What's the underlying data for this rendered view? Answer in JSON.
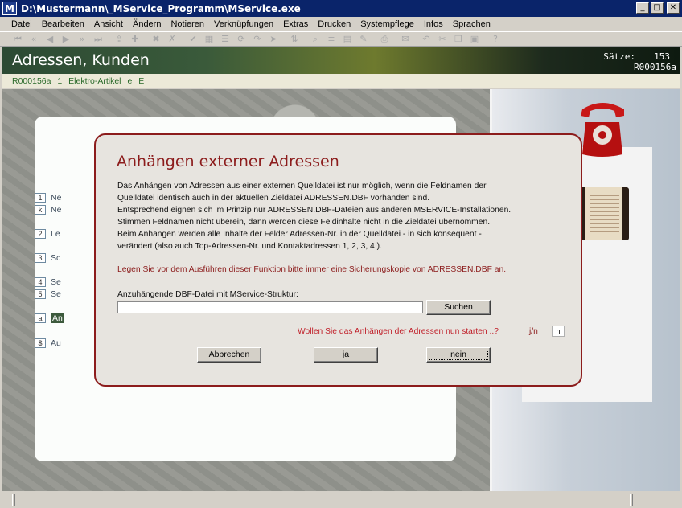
{
  "window": {
    "app_icon": "M",
    "title": "D:\\Mustermann\\_MService_Programm\\MService.exe",
    "minimize": "_",
    "maximize": "□",
    "close": "✕"
  },
  "menu": [
    "Datei",
    "Bearbeiten",
    "Ansicht",
    "Ändern",
    "Notieren",
    "Verknüpfungen",
    "Extras",
    "Drucken",
    "Systempflege",
    "Infos",
    "Sprachen"
  ],
  "toolbar_icons": [
    "first-icon",
    "prev-page-icon",
    "prev-icon",
    "next-icon",
    "next-page-icon",
    "last-icon",
    "sep",
    "import-icon",
    "new-icon",
    "sep",
    "delete-icon",
    "cancel-icon",
    "sep",
    "confirm-icon",
    "record-icon",
    "list-icon",
    "link-icon",
    "link2-icon",
    "link3-icon",
    "sep",
    "sort-icon",
    "sep",
    "search-icon",
    "list2-icon",
    "view-icon",
    "pencil-icon",
    "sep",
    "print-icon",
    "sep",
    "mail-icon",
    "sep",
    "undo-icon",
    "cut-icon",
    "copy-icon",
    "paste-icon",
    "sep",
    "help-icon"
  ],
  "header": {
    "title": "Adressen, Kunden",
    "count_label": "Sätze:",
    "count_value": "153",
    "record_id": "R000156a"
  },
  "info_row": [
    "R000156a",
    "1",
    "Elektro-Artikel",
    "e",
    "E"
  ],
  "side_menu": [
    {
      "key": "1",
      "text": "Ne"
    },
    {
      "key": "k",
      "text": "Ne"
    },
    {
      "key": "2",
      "text": "Le"
    },
    {
      "key": "3",
      "text": "Sc"
    },
    {
      "key": "4",
      "text": "Se"
    },
    {
      "key": "5",
      "text": "Se"
    },
    {
      "key": "a",
      "text": "An"
    },
    {
      "key": "$",
      "text": "Au"
    }
  ],
  "dialog": {
    "title": "Anhängen externer Adressen",
    "paragraph": [
      "Das Anhängen von Adressen aus einer externen Quelldatei ist nur möglich,  wenn die Feldnamen der",
      "Quelldatei identisch auch in der aktuellen Zieldatei ADRESSEN.DBF vorhanden sind.",
      "Entsprechend eignen sich im Prinzip nur ADRESSEN.DBF-Dateien aus anderen MSERVICE-Installationen.",
      "Stimmen Feldnamen nicht überein, dann werden diese Feldinhalte nicht in die Zieldatei übernommen.",
      "Beim Anhängen werden alle Inhalte der Felder Adressen-Nr. in der Quelldatei  - in sich konsequent -",
      "verändert (also auch Top-Adressen-Nr. und Kontaktadressen 1, 2, 3, 4 )."
    ],
    "warning": "Legen Sie vor dem Ausführen dieser Funktion bitte immer eine Sicherungskopie von ADRESSEN.DBF an.",
    "file_label": "Anzuhängende DBF-Datei mit MService-Struktur:",
    "file_value": "",
    "search_button": "Suchen",
    "question": "Wollen Sie das Anhängen der Adressen nun starten ..?",
    "question_yn": "j/n",
    "answer_value": "n",
    "cancel_button": "Abbrechen",
    "yes_button": "ja",
    "no_button": "nein"
  }
}
